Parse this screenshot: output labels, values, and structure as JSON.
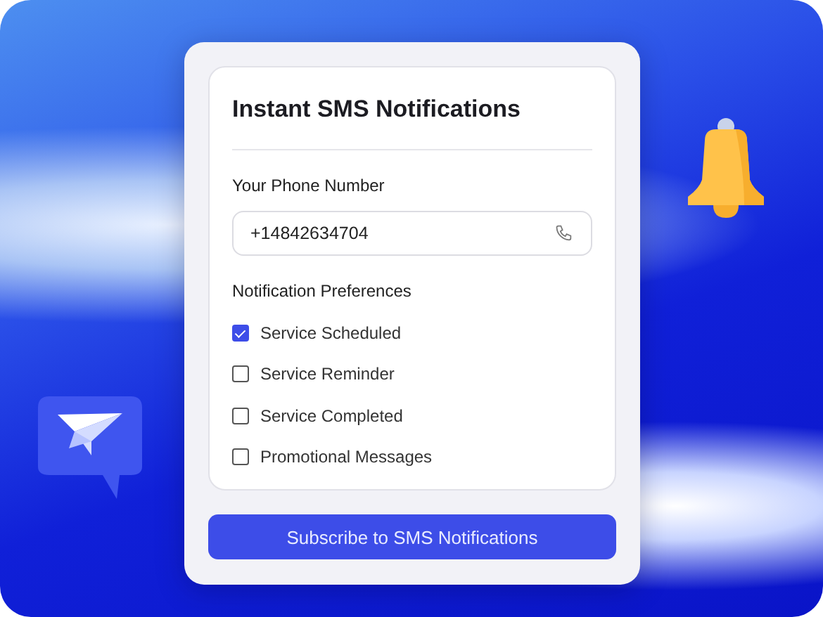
{
  "card": {
    "title": "Instant SMS Notifications",
    "phone": {
      "label": "Your Phone Number",
      "value": "+14842634704"
    },
    "preferences": {
      "label": "Notification Preferences",
      "options": [
        {
          "label": "Service Scheduled",
          "checked": true
        },
        {
          "label": "Service Reminder",
          "checked": false
        },
        {
          "label": "Service Completed",
          "checked": false
        },
        {
          "label": "Promotional Messages",
          "checked": false
        }
      ]
    }
  },
  "subscribe_button": "Subscribe to SMS Notifications"
}
